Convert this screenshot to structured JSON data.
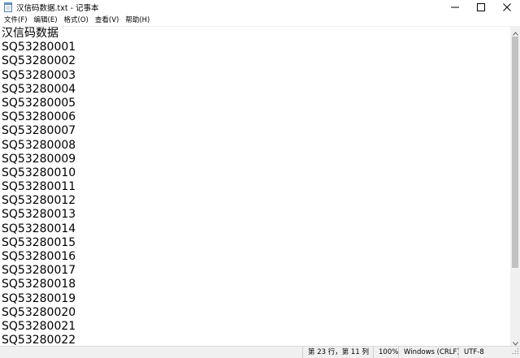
{
  "window": {
    "title": "汉信码数据.txt - 记事本",
    "icon": "notepad-icon",
    "controls": [
      "minimize-icon",
      "maximize-icon",
      "close-icon"
    ]
  },
  "menubar": {
    "items": [
      {
        "label": "文件(F)"
      },
      {
        "label": "编辑(E)"
      },
      {
        "label": "格式(O)"
      },
      {
        "label": "查看(V)"
      },
      {
        "label": "帮助(H)"
      }
    ]
  },
  "editor": {
    "lines": [
      "汉信码数据",
      "SQ53280001",
      "SQ53280002",
      "SQ53280003",
      "SQ53280004",
      "SQ53280005",
      "SQ53280006",
      "SQ53280007",
      "SQ53280008",
      "SQ53280009",
      "SQ53280010",
      "SQ53280011",
      "SQ53280012",
      "SQ53280013",
      "SQ53280014",
      "SQ53280015",
      "SQ53280016",
      "SQ53280017",
      "SQ53280018",
      "SQ53280019",
      "SQ53280020",
      "SQ53280021",
      "SQ53280022"
    ]
  },
  "statusbar": {
    "position": "第 23 行，第 11 列",
    "zoom": "100%",
    "line_ending": "Windows (CRLF)",
    "encoding": "UTF-8"
  },
  "colors": {
    "scrollbar_track": "#f0f0f0",
    "scrollbar_thumb": "#c2c2c2",
    "statusbar_bg": "#f0f0f0"
  }
}
